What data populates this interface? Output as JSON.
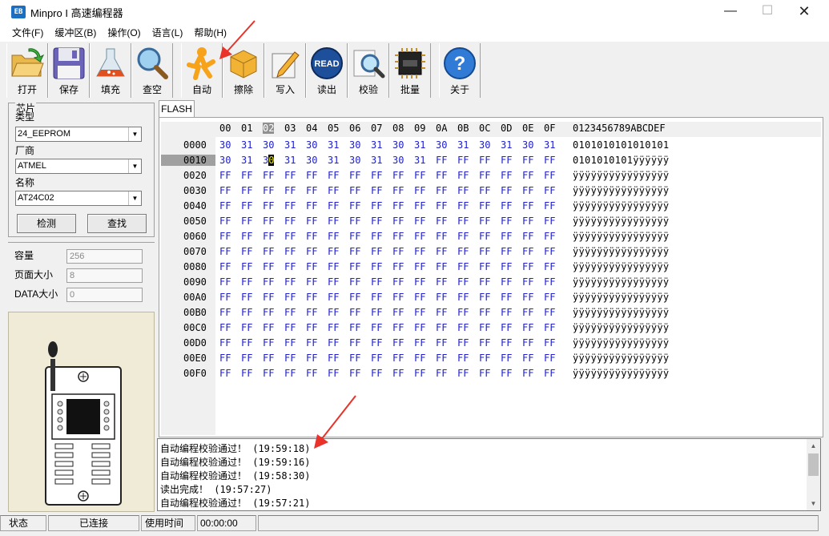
{
  "window": {
    "title": "Minpro I 高速编程器",
    "icon_text": "EB"
  },
  "menu": [
    {
      "label": "文件(F)"
    },
    {
      "label": "缓冲区(B)"
    },
    {
      "label": "操作(O)"
    },
    {
      "label": "语言(L)"
    },
    {
      "label": "帮助(H)"
    }
  ],
  "toolbar": [
    {
      "label": "打开",
      "icon": "open-folder-icon"
    },
    {
      "label": "保存",
      "icon": "floppy-disk-icon"
    },
    {
      "label": "填充",
      "icon": "flask-icon"
    },
    {
      "label": "查空",
      "icon": "magnifier-icon"
    },
    {
      "label": "自动",
      "icon": "running-man-icon"
    },
    {
      "label": "擦除",
      "icon": "box-icon"
    },
    {
      "label": "写入",
      "icon": "pen-icon"
    },
    {
      "label": "读出",
      "icon": "read-icon",
      "icon_text": "READ"
    },
    {
      "label": "校验",
      "icon": "verify-magnifier-icon"
    },
    {
      "label": "批量",
      "icon": "chip-icon"
    },
    {
      "label": "关于",
      "icon": "help-icon"
    }
  ],
  "chip": {
    "group_title": "芯片",
    "type_label": "类型",
    "type_value": "24_EEPROM",
    "vendor_label": "厂商",
    "vendor_value": "ATMEL",
    "name_label": "名称",
    "name_value": "AT24C02",
    "detect_button": "检测",
    "search_button": "查找"
  },
  "info": {
    "capacity_label": "容量",
    "capacity_value": "256",
    "page_label": "页面大小",
    "page_value": "8",
    "data_label": "DATA大小",
    "data_value": "0"
  },
  "tabs": [
    {
      "label": "FLASH"
    }
  ],
  "hex": {
    "columns": [
      "00",
      "01",
      "02",
      "03",
      "04",
      "05",
      "06",
      "07",
      "08",
      "09",
      "0A",
      "0B",
      "0C",
      "0D",
      "0E",
      "0F"
    ],
    "ascii_header": "0123456789ABCDEF",
    "selected_column": "02",
    "selected_row": "0010",
    "cursor_cell": "0",
    "rows": [
      {
        "addr": "0000",
        "bytes": [
          "30",
          "31",
          "30",
          "31",
          "30",
          "31",
          "30",
          "31",
          "30",
          "31",
          "30",
          "31",
          "30",
          "31",
          "30",
          "31"
        ],
        "ascii": "0101010101010101"
      },
      {
        "addr": "0010",
        "bytes": [
          "30",
          "31",
          "30",
          "31",
          "30",
          "31",
          "30",
          "31",
          "30",
          "31",
          "FF",
          "FF",
          "FF",
          "FF",
          "FF",
          "FF"
        ],
        "ascii": "0101010101ÿÿÿÿÿÿ"
      },
      {
        "addr": "0020",
        "bytes": [
          "FF",
          "FF",
          "FF",
          "FF",
          "FF",
          "FF",
          "FF",
          "FF",
          "FF",
          "FF",
          "FF",
          "FF",
          "FF",
          "FF",
          "FF",
          "FF"
        ],
        "ascii": "ÿÿÿÿÿÿÿÿÿÿÿÿÿÿÿÿ"
      },
      {
        "addr": "0030",
        "bytes": [
          "FF",
          "FF",
          "FF",
          "FF",
          "FF",
          "FF",
          "FF",
          "FF",
          "FF",
          "FF",
          "FF",
          "FF",
          "FF",
          "FF",
          "FF",
          "FF"
        ],
        "ascii": "ÿÿÿÿÿÿÿÿÿÿÿÿÿÿÿÿ"
      },
      {
        "addr": "0040",
        "bytes": [
          "FF",
          "FF",
          "FF",
          "FF",
          "FF",
          "FF",
          "FF",
          "FF",
          "FF",
          "FF",
          "FF",
          "FF",
          "FF",
          "FF",
          "FF",
          "FF"
        ],
        "ascii": "ÿÿÿÿÿÿÿÿÿÿÿÿÿÿÿÿ"
      },
      {
        "addr": "0050",
        "bytes": [
          "FF",
          "FF",
          "FF",
          "FF",
          "FF",
          "FF",
          "FF",
          "FF",
          "FF",
          "FF",
          "FF",
          "FF",
          "FF",
          "FF",
          "FF",
          "FF"
        ],
        "ascii": "ÿÿÿÿÿÿÿÿÿÿÿÿÿÿÿÿ"
      },
      {
        "addr": "0060",
        "bytes": [
          "FF",
          "FF",
          "FF",
          "FF",
          "FF",
          "FF",
          "FF",
          "FF",
          "FF",
          "FF",
          "FF",
          "FF",
          "FF",
          "FF",
          "FF",
          "FF"
        ],
        "ascii": "ÿÿÿÿÿÿÿÿÿÿÿÿÿÿÿÿ"
      },
      {
        "addr": "0070",
        "bytes": [
          "FF",
          "FF",
          "FF",
          "FF",
          "FF",
          "FF",
          "FF",
          "FF",
          "FF",
          "FF",
          "FF",
          "FF",
          "FF",
          "FF",
          "FF",
          "FF"
        ],
        "ascii": "ÿÿÿÿÿÿÿÿÿÿÿÿÿÿÿÿ"
      },
      {
        "addr": "0080",
        "bytes": [
          "FF",
          "FF",
          "FF",
          "FF",
          "FF",
          "FF",
          "FF",
          "FF",
          "FF",
          "FF",
          "FF",
          "FF",
          "FF",
          "FF",
          "FF",
          "FF"
        ],
        "ascii": "ÿÿÿÿÿÿÿÿÿÿÿÿÿÿÿÿ"
      },
      {
        "addr": "0090",
        "bytes": [
          "FF",
          "FF",
          "FF",
          "FF",
          "FF",
          "FF",
          "FF",
          "FF",
          "FF",
          "FF",
          "FF",
          "FF",
          "FF",
          "FF",
          "FF",
          "FF"
        ],
        "ascii": "ÿÿÿÿÿÿÿÿÿÿÿÿÿÿÿÿ"
      },
      {
        "addr": "00A0",
        "bytes": [
          "FF",
          "FF",
          "FF",
          "FF",
          "FF",
          "FF",
          "FF",
          "FF",
          "FF",
          "FF",
          "FF",
          "FF",
          "FF",
          "FF",
          "FF",
          "FF"
        ],
        "ascii": "ÿÿÿÿÿÿÿÿÿÿÿÿÿÿÿÿ"
      },
      {
        "addr": "00B0",
        "bytes": [
          "FF",
          "FF",
          "FF",
          "FF",
          "FF",
          "FF",
          "FF",
          "FF",
          "FF",
          "FF",
          "FF",
          "FF",
          "FF",
          "FF",
          "FF",
          "FF"
        ],
        "ascii": "ÿÿÿÿÿÿÿÿÿÿÿÿÿÿÿÿ"
      },
      {
        "addr": "00C0",
        "bytes": [
          "FF",
          "FF",
          "FF",
          "FF",
          "FF",
          "FF",
          "FF",
          "FF",
          "FF",
          "FF",
          "FF",
          "FF",
          "FF",
          "FF",
          "FF",
          "FF"
        ],
        "ascii": "ÿÿÿÿÿÿÿÿÿÿÿÿÿÿÿÿ"
      },
      {
        "addr": "00D0",
        "bytes": [
          "FF",
          "FF",
          "FF",
          "FF",
          "FF",
          "FF",
          "FF",
          "FF",
          "FF",
          "FF",
          "FF",
          "FF",
          "FF",
          "FF",
          "FF",
          "FF"
        ],
        "ascii": "ÿÿÿÿÿÿÿÿÿÿÿÿÿÿÿÿ"
      },
      {
        "addr": "00E0",
        "bytes": [
          "FF",
          "FF",
          "FF",
          "FF",
          "FF",
          "FF",
          "FF",
          "FF",
          "FF",
          "FF",
          "FF",
          "FF",
          "FF",
          "FF",
          "FF",
          "FF"
        ],
        "ascii": "ÿÿÿÿÿÿÿÿÿÿÿÿÿÿÿÿ"
      },
      {
        "addr": "00F0",
        "bytes": [
          "FF",
          "FF",
          "FF",
          "FF",
          "FF",
          "FF",
          "FF",
          "FF",
          "FF",
          "FF",
          "FF",
          "FF",
          "FF",
          "FF",
          "FF",
          "FF"
        ],
        "ascii": "ÿÿÿÿÿÿÿÿÿÿÿÿÿÿÿÿ"
      }
    ]
  },
  "log": [
    "自动编程校验通过！ (19:59:18)",
    "自动编程校验通过！ (19:59:16)",
    "自动编程校验通过！ (19:58:30)",
    "读出完成！ (19:57:27)",
    "自动编程校验通过！ (19:57:21)"
  ],
  "status": {
    "state_label": "状态",
    "state_value": "已连接",
    "time_label": "使用时间",
    "time_value": "00:00:00"
  },
  "colors": {
    "hex_text": "#2020d0",
    "annotation_arrow": "#e8322a",
    "chip_pane": "#efebd6"
  }
}
